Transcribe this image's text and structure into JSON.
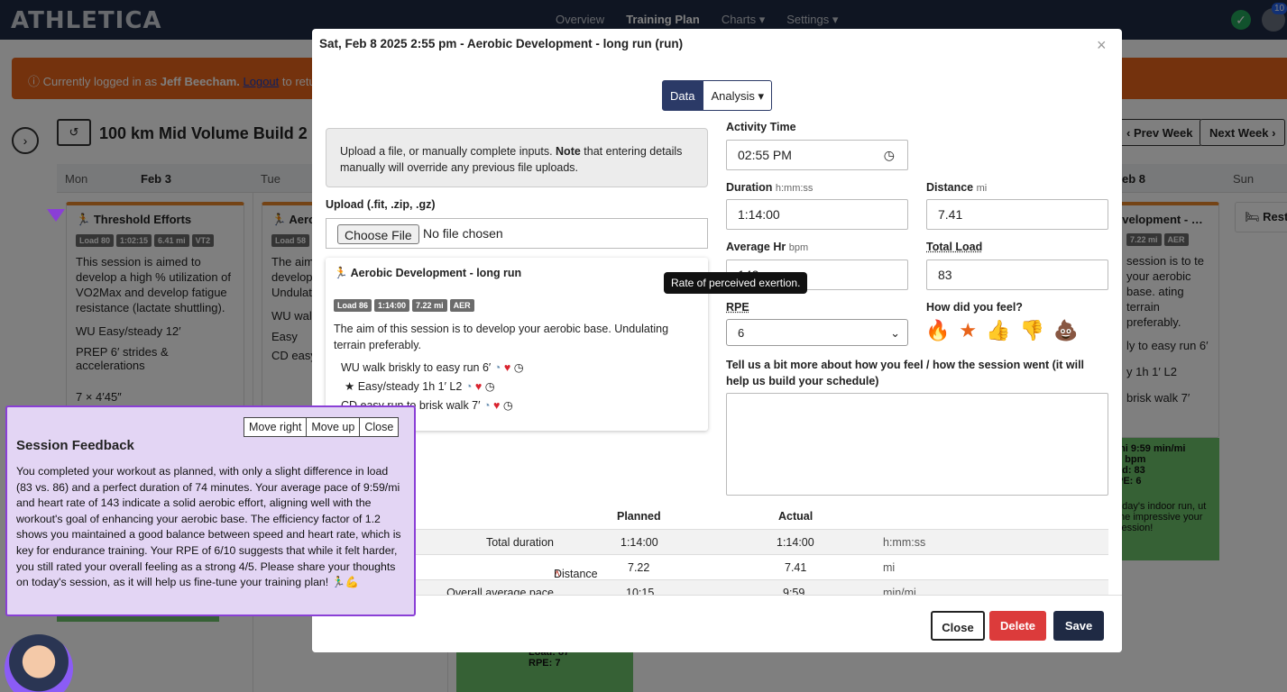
{
  "nav": {
    "brand": "ATHLETICA",
    "links": [
      "Overview",
      "Training Plan",
      "Charts ▾",
      "Settings ▾"
    ],
    "badge": "10"
  },
  "page": {
    "alert_prefix": "Currently logged in as",
    "alert_user": "Jeff Beecham.",
    "alert_link": "Logout",
    "alert_suffix": "to retur",
    "plan_title": "100 km Mid Volume Build 2",
    "prev_week": "Prev Week",
    "next_week": "Next Week",
    "days": [
      "Mon",
      "Feb 3",
      "Tue",
      "Sun"
    ],
    "feb8": "eb 8",
    "cards": {
      "mon_title": "Threshold Efforts",
      "mon_tags": [
        "Load 80",
        "1:02:15",
        "6.41 mi",
        "VT2"
      ],
      "mon_desc": "This session is aimed to develop a high % utilization of VO2Max and develop fatigue resistance (lactate shuttling).",
      "mon_step1": "WU Easy/steady 12′",
      "mon_step2": "PREP 6′ strides & accelerations",
      "mon_step3": "7 × 4′45″",
      "tue_title": "Aero",
      "tue_tag": "Load 58",
      "tue_desc": "The aim develop Undulatin",
      "tue_s1": "WU walk",
      "tue_s2": "Easy",
      "tue_s3": "CD easy",
      "sat_title": "evelopment - …",
      "sat_tags": [
        "7.22 mi",
        "AER"
      ],
      "sat_desc": "session is to te your aerobic base. ating terrain preferably.",
      "sat_s1": "ly to easy run 6′",
      "sat_s2": "y 1h 1′ L2",
      "sat_s3": "brisk walk 7′",
      "sat_g1": "mi  9:59 min/mi",
      "sat_g2": "3 bpm",
      "sat_g3": "ad: 83",
      "sat_g4": "PE: 6",
      "sat_g5": "oday's indoor run, ut the impressive your session!",
      "sun_title": "Rest",
      "wed_g1": "Load: 87",
      "wed_g2": "RPE: 7"
    }
  },
  "modal": {
    "title": "Sat, Feb 8 2025 2:55 pm - Aerobic Development - long run (run)",
    "tab_data": "Data",
    "tab_analysis": "Analysis ▾",
    "info_text": "Upload a file, or manually complete inputs.",
    "info_note": "Note",
    "info_rest": "that entering details manually will override any previous file uploads.",
    "upload_label": "Upload (.fit, .zip, .gz)",
    "choose_file": "Choose File",
    "no_file": "No file chosen",
    "session": {
      "title": "Aerobic Development - long run",
      "tags": [
        "Load 86",
        "1:14:00",
        "7.22 mi",
        "AER"
      ],
      "desc": "The aim of this session is to develop your aerobic base. Undulating terrain preferably.",
      "step1": "WU walk briskly to easy run 6′",
      "step2": "Easy/steady 1h 1′ L2",
      "step3": "CD easy run to brisk walk 7′"
    },
    "activity_time_label": "Activity Time",
    "activity_time": "02:55 PM",
    "duration_label": "Duration",
    "duration_unit": "h:mm:ss",
    "duration": "1:14:00",
    "distance_label": "Distance",
    "distance_unit": "mi",
    "distance": "7.41",
    "avg_hr_label": "Average Hr",
    "avg_hr_unit": "bpm",
    "avg_hr": "143",
    "total_load_label": "Total Load",
    "total_load": "83",
    "tooltip": "Rate of perceived exertion.",
    "rpe_label": "RPE",
    "rpe": "6",
    "feel_label": "How did you feel?",
    "feel_icons": [
      "fire-icon",
      "star-icon",
      "thumbs-up-icon",
      "thumbs-down-icon",
      "poop-icon"
    ],
    "feel_selected": "star-icon",
    "tell_label": "Tell us a bit more about how you feel / how the session went (it will help us build your schedule)",
    "table": {
      "planned": "Planned",
      "actual": "Actual",
      "rows": [
        {
          "label": "Total duration",
          "planned": "1:14:00",
          "actual": "1:14:00",
          "unit": "h:mm:ss"
        },
        {
          "label": "Distance",
          "planned": "7.22",
          "actual": "7.41",
          "unit": "mi"
        },
        {
          "label": "Overall average pace",
          "planned": "10:15",
          "actual": "9:59",
          "unit": "min/mi"
        }
      ]
    },
    "close": "Close",
    "delete": "Delete",
    "save": "Save"
  },
  "feedback": {
    "move_right": "Move right",
    "move_up": "Move up",
    "close": "Close",
    "title": "Session Feedback",
    "text": "You completed your workout as planned, with only a slight difference in load (83 vs. 86) and a perfect duration of 74 minutes. Your average pace of 9:59/mi and heart rate of 143 indicate a solid aerobic effort, aligning well with the workout's goal of enhancing your aerobic base. The efficiency factor of 1.2 shows you maintained a good balance between speed and heart rate, which is key for endurance training. Your RPE of 6/10 suggests that while it felt harder, you still rated your overall feeling as a strong 4/5. Please share your thoughts on today's session, as it will help us fine-tune your training plan! 🏃‍♂️💪"
  }
}
